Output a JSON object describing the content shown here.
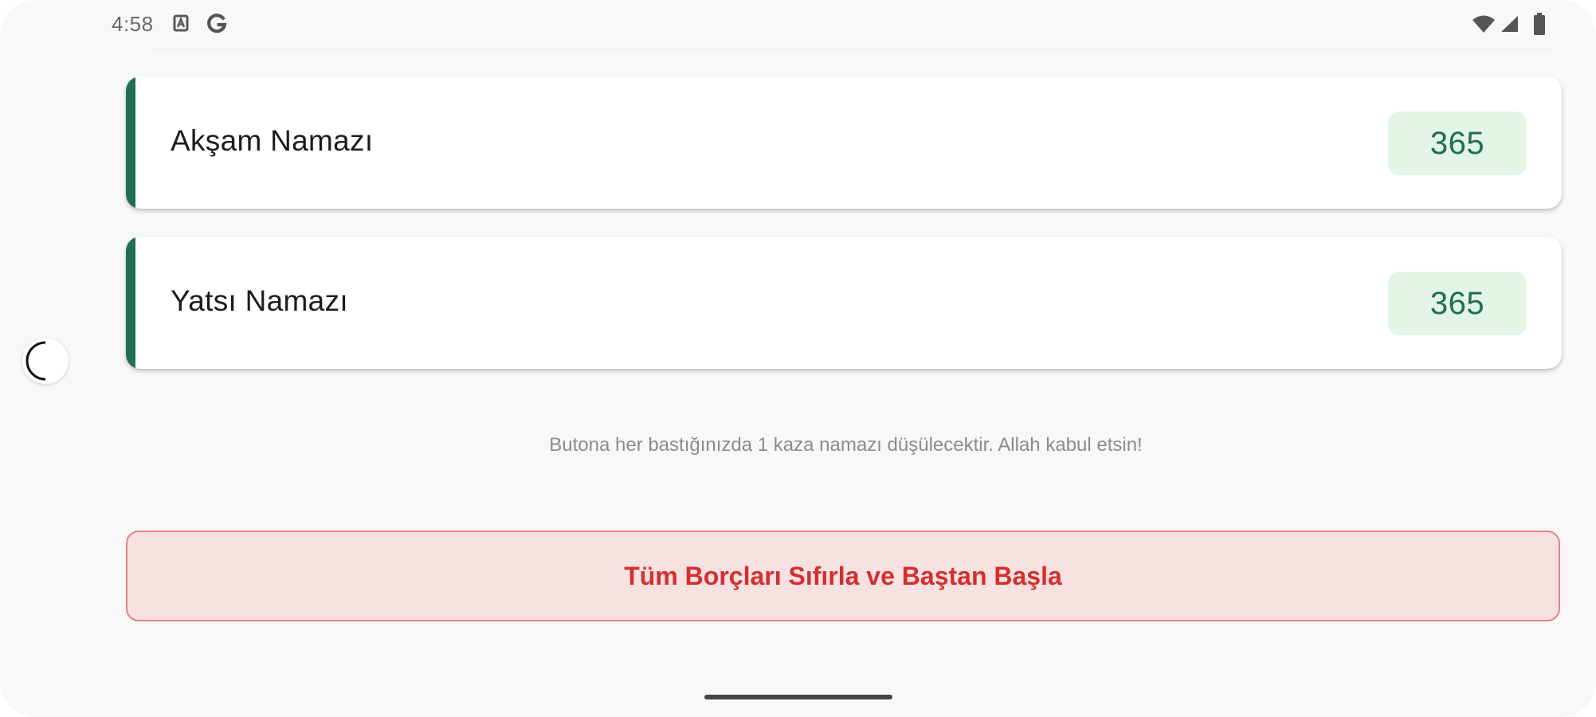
{
  "status_bar": {
    "time": "4:58",
    "left_icons": [
      "notification-a-icon",
      "google-g-icon"
    ],
    "right_icons": [
      "wifi-icon",
      "signal-icon",
      "battery-icon"
    ]
  },
  "cards": [
    {
      "title": "Akşam Namazı",
      "count": "365"
    },
    {
      "title": "Yatsı Namazı",
      "count": "365"
    }
  ],
  "hint": "Butona her bastığınızda 1 kaza namazı düşülecektir. Allah kabul etsin!",
  "reset_button": {
    "label": "Tüm Borçları Sıfırla ve Baştan Başla"
  },
  "colors": {
    "accent": "#1f6e55",
    "badge_bg": "#e3f5e6",
    "danger": "#d32f2f",
    "danger_bg": "#f7e1e1"
  }
}
